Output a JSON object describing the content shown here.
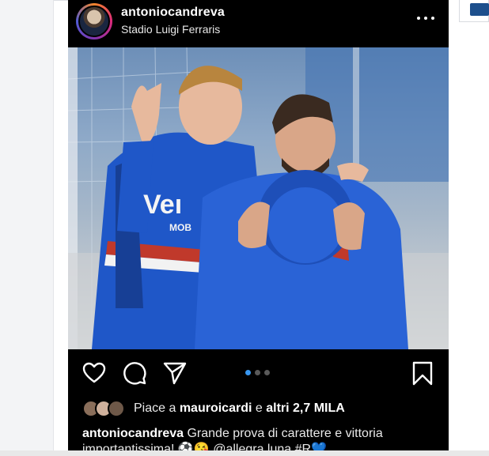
{
  "post": {
    "username": "antoniocandreva",
    "location": "Stadio Luigi Ferraris",
    "more_icon": "more-horizontal-icon",
    "carousel": {
      "count": 3,
      "active_index": 0
    },
    "likes": {
      "prefix": "Piace a",
      "first_liker": "mauroicardi",
      "connector": "e",
      "others": "altri 2,7 MILA"
    },
    "caption": {
      "username": "antoniocandreva",
      "text": "Grande prova di carattere e vittoria importantissima! ⚽️😘 @allegra.luna #R💙"
    },
    "icons": {
      "like": "heart-icon",
      "comment": "comment-icon",
      "share": "send-icon",
      "save": "bookmark-icon"
    },
    "colors": {
      "background": "#000000",
      "text": "#ffffff",
      "carousel_active": "#3897f0",
      "jersey_blue": "#1f57c8"
    }
  }
}
